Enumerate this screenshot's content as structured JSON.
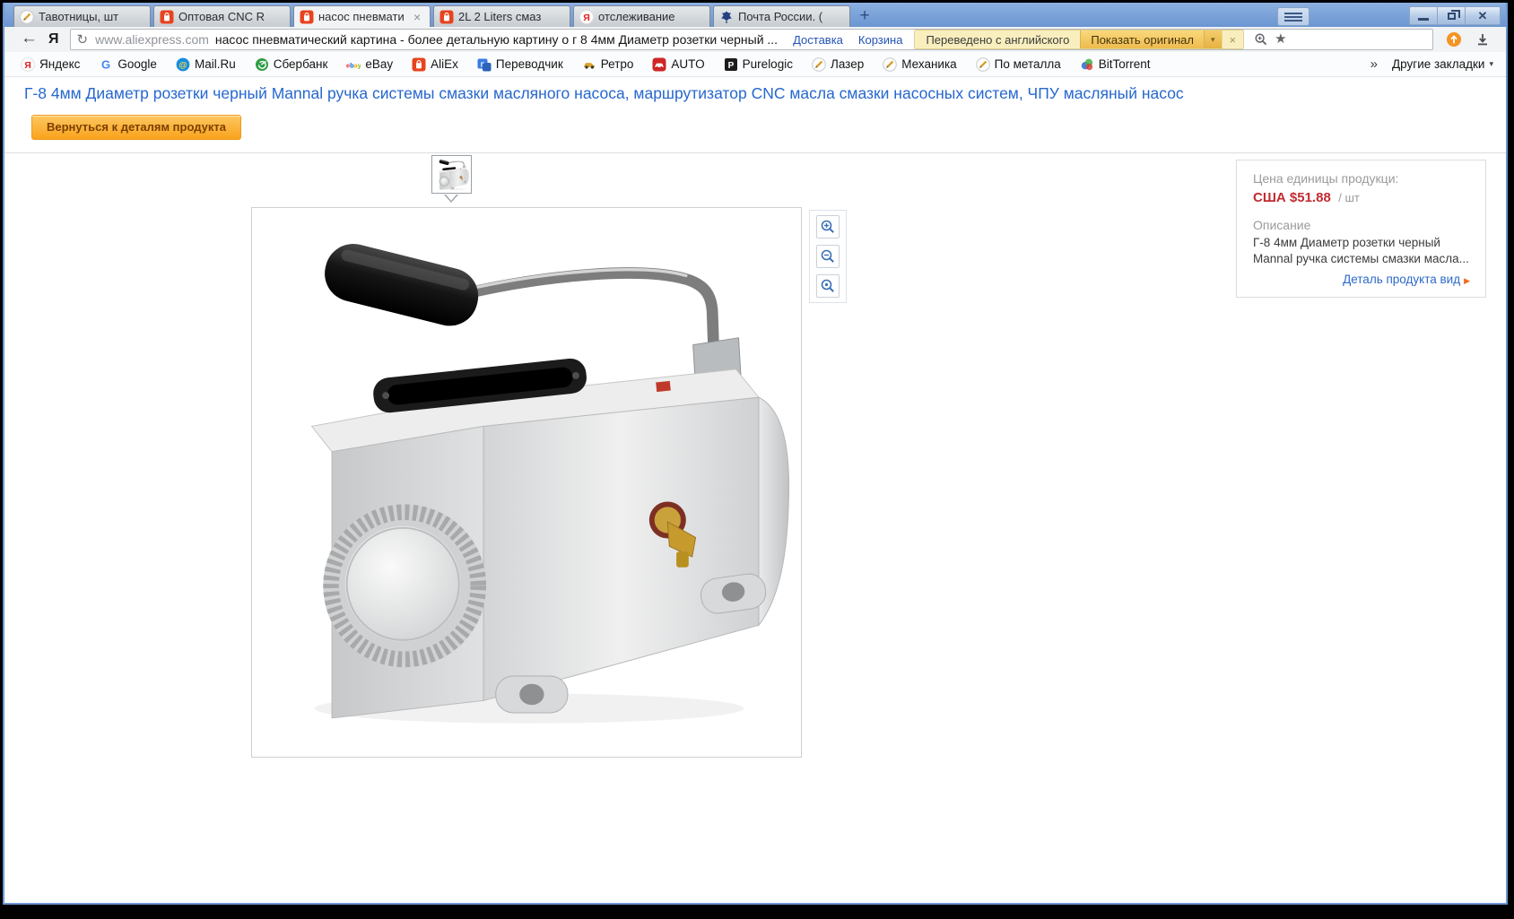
{
  "window": {
    "tabs": [
      {
        "label": "Тавотницы, шт",
        "icon": "pencil",
        "active": false
      },
      {
        "label": "Оптовая CNC R",
        "icon": "aliexpress",
        "active": false
      },
      {
        "label": "насос пневмати",
        "icon": "aliexpress",
        "active": true
      },
      {
        "label": "2L 2 Liters смаз",
        "icon": "aliexpress",
        "active": false
      },
      {
        "label": "отслеживание",
        "icon": "yandex",
        "active": false
      },
      {
        "label": "Почта России. (",
        "icon": "russian-post",
        "active": false
      }
    ]
  },
  "toolbar": {
    "url_domain": "www.aliexpress.com",
    "url_query": "насос пневматический картина - более детальную картину о г 8 4мм Диаметр розетки черный ...",
    "delivery_link": "Доставка",
    "cart_link": "Корзина",
    "translate": {
      "status": "Переведено с английского",
      "action": "Показать оригинал"
    }
  },
  "bookmarks": {
    "items": [
      {
        "label": "Яндекс",
        "icon": "yandex"
      },
      {
        "label": "Google",
        "icon": "google"
      },
      {
        "label": "Mail.Ru",
        "icon": "mailru"
      },
      {
        "label": "Сбербанк",
        "icon": "sberbank"
      },
      {
        "label": "eBay",
        "icon": "ebay"
      },
      {
        "label": "AliEx",
        "icon": "aliexpress"
      },
      {
        "label": "Переводчик",
        "icon": "translate"
      },
      {
        "label": "Ретро",
        "icon": "car"
      },
      {
        "label": "AUTO",
        "icon": "auto"
      },
      {
        "label": "Purelogic",
        "icon": "purelogic"
      },
      {
        "label": "Лазер",
        "icon": "pencil"
      },
      {
        "label": "Механика",
        "icon": "pencil"
      },
      {
        "label": "По металла",
        "icon": "pencil"
      },
      {
        "label": "BitTorrent",
        "icon": "bittorrent"
      }
    ],
    "other_label": "Другие закладки"
  },
  "page": {
    "title": "Г-8 4мм Диаметр розетки черный Mannal ручка системы смазки масляного насоса, маршрутизатор CNC масла смазки насосных систем, ЧПУ масляный насос",
    "back_button_label": "Вернуться к деталям продукта",
    "panel": {
      "price_label": "Цена единицы продукци:",
      "price": "США $51.88",
      "price_unit": "/ шт",
      "desc_label": "Описание",
      "desc": "Г-8 4мм Диаметр розетки черный Mannal ручка системы смазки масла...",
      "detail_link": "Деталь продукта вид"
    }
  },
  "colors": {
    "accent_blue_title": "#2667cf",
    "price_red": "#c12b31",
    "button_orange": "#f9a31c",
    "translate_yellow": "#f9efbe",
    "chrome_blue": "#6b96d1",
    "aliexpress_orange": "#e8431f"
  }
}
